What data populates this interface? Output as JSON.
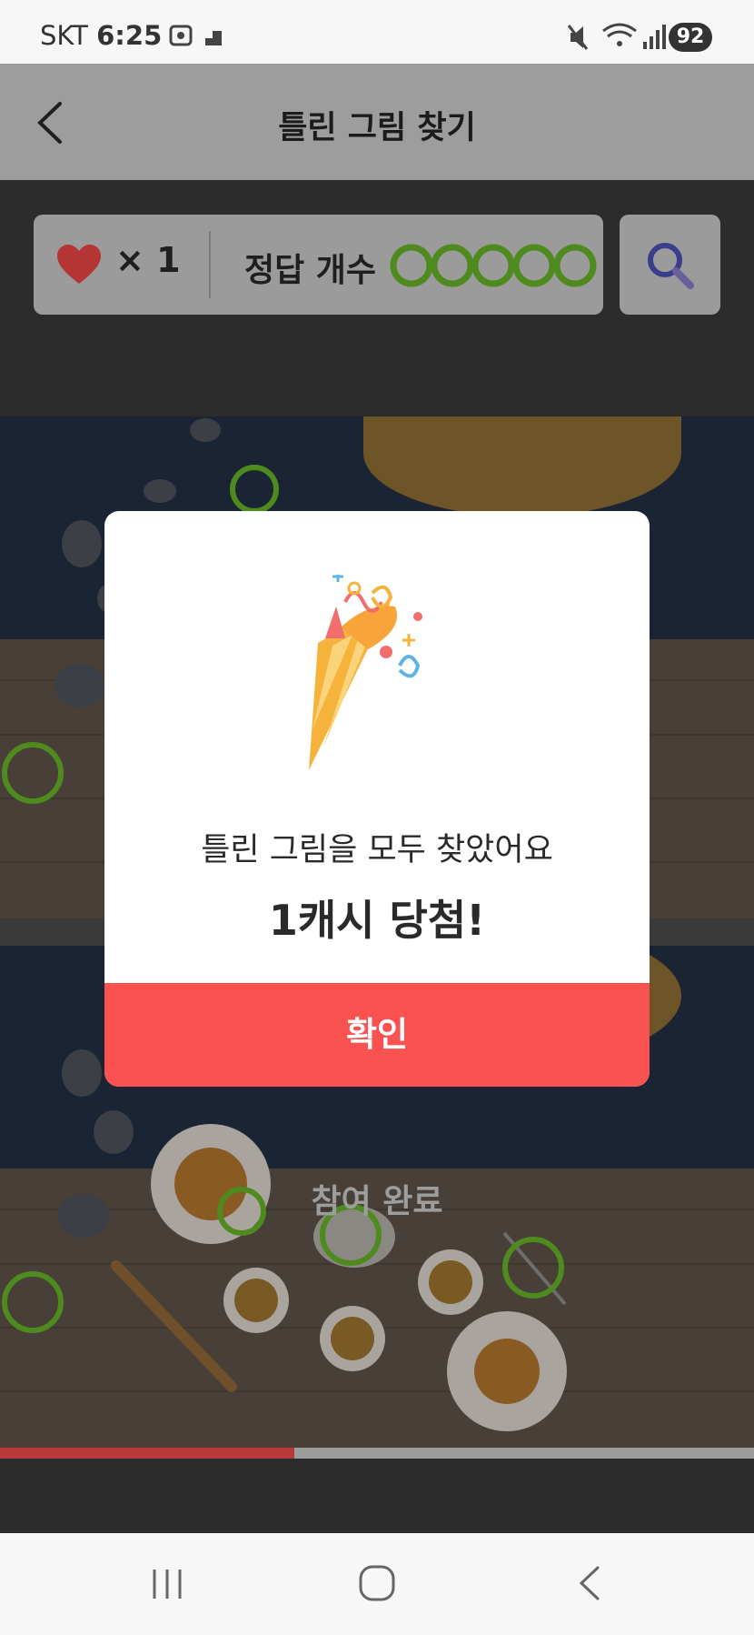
{
  "status_bar": {
    "carrier": "SKT",
    "time": "6:25",
    "battery": "92"
  },
  "header": {
    "title": "틀린 그림 찾기",
    "back_icon": "chevron-left-icon"
  },
  "hud": {
    "lives_label": "× 1",
    "heart_icon": "heart-icon",
    "answer_label": "정답 개수",
    "answers_found": 5,
    "answers_total": 5,
    "hint_icon": "search-icon",
    "ring_color": "#4e8a1e"
  },
  "game": {
    "completed_label": "참여 완료",
    "progress_fraction": 0.39
  },
  "dialog": {
    "icon": "party-popper-icon",
    "message": "틀린 그림을 모두 찾았어요",
    "prize": "1캐시 당첨!",
    "confirm_label": "확인",
    "accent_color": "#fa5151"
  },
  "nav_bar": {
    "recents_icon": "recents-icon",
    "home_icon": "home-icon",
    "back_icon": "back-icon"
  }
}
